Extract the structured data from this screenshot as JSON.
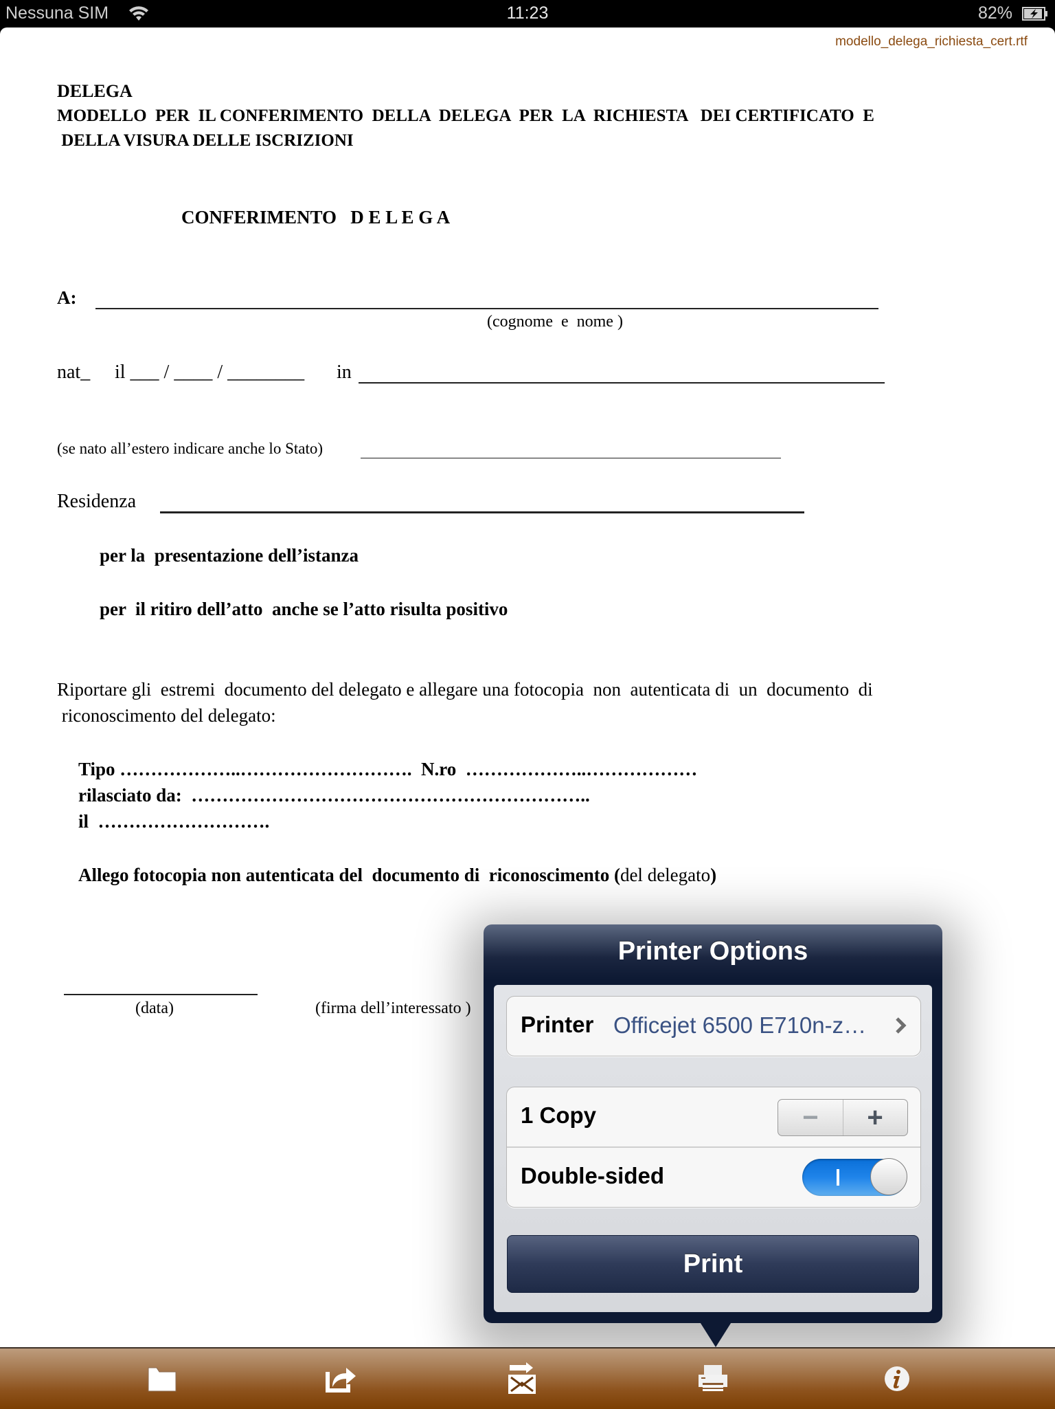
{
  "status_bar": {
    "carrier": "Nessuna SIM",
    "time": "11:23",
    "battery_percent": "82%"
  },
  "document": {
    "filename": "modello_delega_richiesta_cert.rtf",
    "heading": "DELEGA",
    "subheading_line1": "MODELLO  PER  IL CONFERIMENTO  DELLA  DELEGA  PER  LA  RICHIESTA   DEI CERTIFICATO  E",
    "subheading_line2": " DELLA VISURA DELLE ISCRIZIONI",
    "section_title": "CONFERIMENTO   D E L E G A",
    "field_a_label": "A:",
    "field_a_caption": "(cognome  e  nome )",
    "birth_line_nat": "nat_",
    "birth_line_il": "il ___ / ____ / ________",
    "birth_line_in": "in",
    "foreign_note": "(se nato all’estero indicare anche lo Stato)",
    "residence_label": "Residenza",
    "purpose_1": "per la  presentazione dell’istanza",
    "purpose_2": "per  il ritiro dell’atto  anche se l’atto risulta positivo",
    "instructions_line1": "Riportare gli  estremi  documento del delegato e allegare una fotocopia  non  autenticata di  un  documento  di",
    "instructions_line2": " riconoscimento del delegato:",
    "doc_type_line": "Tipo ………………..……………………….  N.ro  ………………..………………",
    "issued_by_line": "rilasciato da:  ………………………………………………………..",
    "issued_on_line": "il  ……………………….",
    "attachment_bold": "Allego fotocopia non autenticata del  documento di  riconoscimento (",
    "attachment_normal": "del delegato",
    "attachment_close": ")",
    "date_caption": "(data)",
    "signature_caption": "(firma dell’interessato )"
  },
  "printer_options": {
    "title": "Printer Options",
    "printer_label": "Printer",
    "printer_value": "Officejet 6500 E710n-z…",
    "copies_label": "1 Copy",
    "copies_value": 1,
    "stepper_minus": "−",
    "stepper_plus": "+",
    "double_sided_label": "Double-sided",
    "double_sided_on": true,
    "print_button": "Print"
  },
  "toolbar": {
    "items": [
      {
        "icon": "folder-icon"
      },
      {
        "icon": "share-icon"
      },
      {
        "icon": "email-icon"
      },
      {
        "icon": "printer-icon"
      },
      {
        "icon": "info-icon"
      }
    ]
  },
  "colors": {
    "filename": "#8a4a10",
    "printer_value": "#3a5283",
    "toggle_on": "#1f84ea",
    "popover_header": "#0d1933",
    "toolbar_brown": "#7c3f03"
  }
}
